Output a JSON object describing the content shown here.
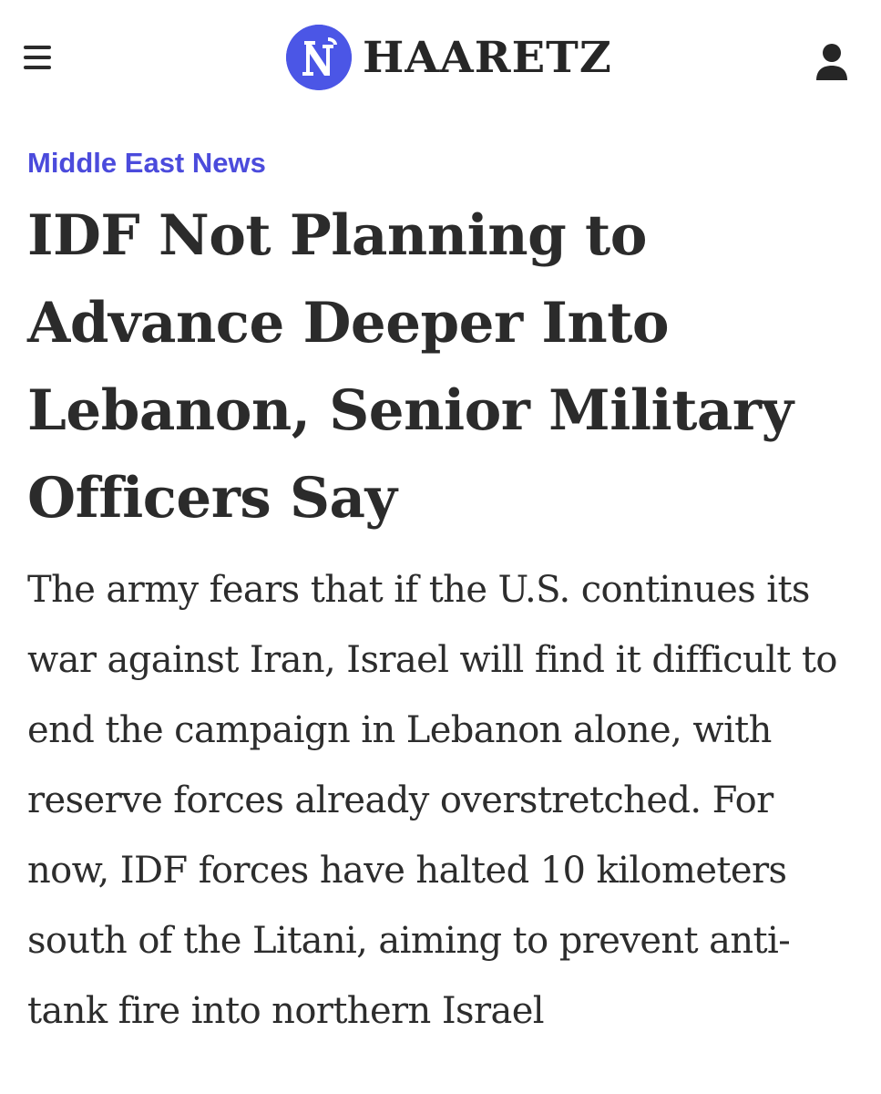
{
  "header": {
    "brand_name": "HAARETZ",
    "menu_icon": "hamburger-menu-icon",
    "account_icon": "user-account-icon",
    "logo_icon": "haaretz-logo-mark",
    "brand_color": "#4b56e6"
  },
  "article": {
    "section": "Middle East News",
    "headline": "IDF Not Planning to Advance Deeper Into Lebanon, Senior Military Officers Say",
    "subheadline": "The army fears that if the U.S. continues its war against Iran, Israel will find it difficult to end the campaign in Lebanon alone, with reserve forces already overstretched. For now, IDF forces have halted 10 kilometers south of the Litani, aiming to prevent anti-tank fire into northern Israel",
    "section_color": "#4b4bdc"
  }
}
